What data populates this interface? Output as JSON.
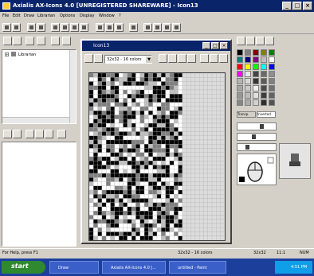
{
  "window": {
    "title": "Axialis AX-Icons 4.0 [UNREGISTERED SHAREWARE] - Icon13"
  },
  "menu": [
    "File",
    "Edit",
    "Draw",
    "Librarian",
    "Options",
    "Display",
    "Window",
    "?"
  ],
  "tree": {
    "root_label": "Librarian"
  },
  "child_window": {
    "title": "Icon13",
    "format_label": "32x32 - 16 colors"
  },
  "palette": {
    "tab_transparent": "Transp.",
    "tab_inverted": "Inverted"
  },
  "status": {
    "help": "For Help, press F1",
    "format": "32x32 - 16 colors",
    "size": "32x32",
    "coords": "11:1",
    "mode": "NUM"
  },
  "taskbar": {
    "start": "start",
    "tasks": [
      "Draw",
      "Axialis AX-Icons 4.0 [...",
      "untitled - Paint"
    ],
    "clock": "4:51 PM"
  }
}
